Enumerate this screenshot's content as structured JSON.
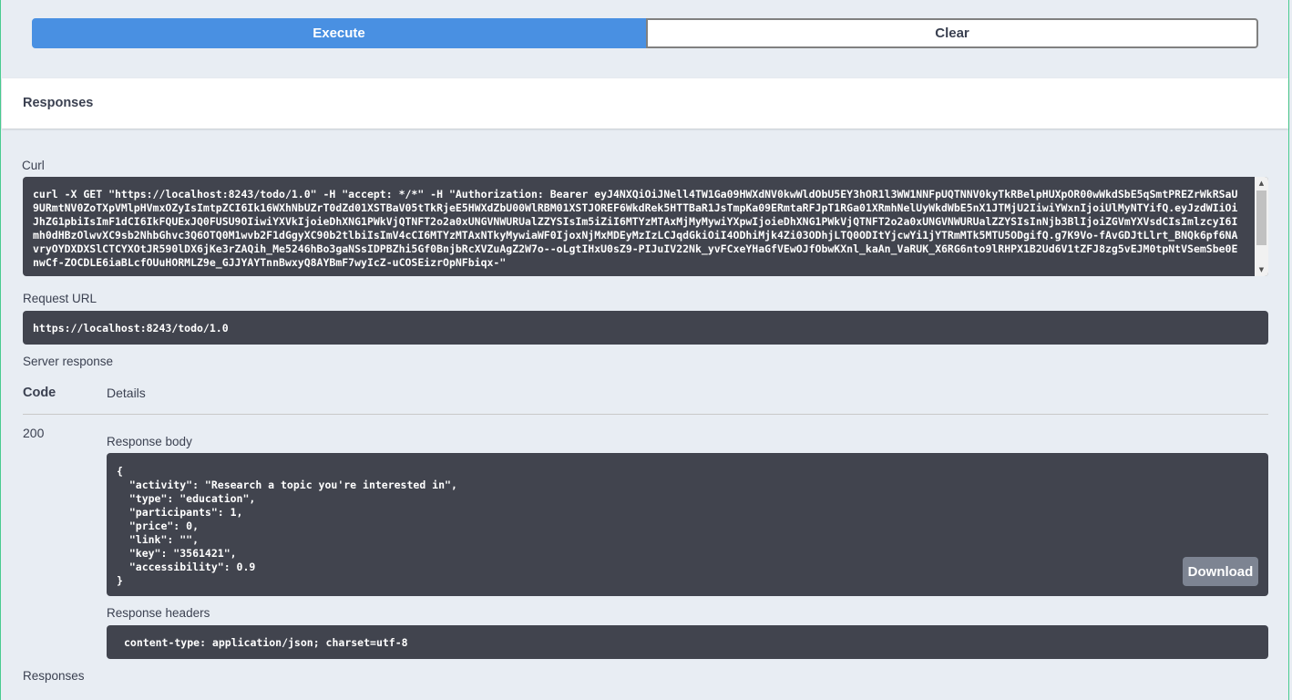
{
  "buttons": {
    "execute": "Execute",
    "clear": "Clear",
    "download": "Download"
  },
  "responses_title": "Responses",
  "curl": {
    "label": "Curl",
    "text": "curl -X GET \"https://localhost:8243/todo/1.0\" -H \"accept: */*\" -H \"Authorization: Bearer eyJ4NXQiOiJNell4TW1Ga09HWXdNV0kwWldObU5EY3hOR1l3WW1NNFpUQTNNV0kyTkRBelpHUXpOR00wWkdSbE5qSmtPREZrWkRSaU9URmtNV0ZoTXpVMlpHVmxOZyIsImtpZCI6Ik16WXhNbUZrT0dZd01XSTBaV05tTkRjeE5HWXdZbU00WlRBM01XSTJOREF6WkdRek5HTTBaR1JsTmpKa09ERmtaRFJpT1RGa01XRmhNelUyWkdWbE5nX1JTMjU2IiwiYWxnIjoiUlMyNTYifQ.eyJzdWIiOiJhZG1pbiIsImF1dCI6IkFQUExJQ0FUSU9OIiwiYXVkIjoieDhXNG1PWkVjQTNFT2o2a0xUNGVNWURUalZZYSIsIm5iZiI6MTYzMTAxMjMyMywiYXpwIjoieDhXNG1PWkVjQTNFT2o2a0xUNGVNWURUalZZYSIsInNjb3BlIjoiZGVmYXVsdCIsImlzcyI6Imh0dHBzOlwvXC9sb2NhbGhvc3Q6OTQ0M1wvb2F1dGgyXC90b2tlbiIsImV4cCI6MTYzMTAxNTkyMywiaWF0IjoxNjMxMDEyMzIzLCJqdGkiOiI4ODhiMjk4Zi03ODhjLTQ0ODItYjcwYi1jYTRmMTk5MTU5ODgifQ.g7K9Vo-fAvGDJtLlrt_BNQk6pf6NAvryOYDXDXSlCTCYXOtJR590lDX6jKe3rZAQih_Me5246hBo3gaNSsIDPBZhi5Gf0BnjbRcXVZuAgZ2W7o--oLgtIHxU0sZ9-PIJuIV22Nk_yvFCxeYHaGfVEwOJfObwKXnl_kaAn_VaRUK_X6RG6nto9lRHPX1B2Ud6V1tZFJ8zg5vEJM0tpNtVSemSbe0EnwCf-ZOCDLE6iaBLcfOUuHORMLZ9e_GJJYAYTnnBwxyQ8AYBmF7wyIcZ-uCOSEizrOpNFbiqx-\""
  },
  "request_url": {
    "label": "Request URL",
    "value": "https://localhost:8243/todo/1.0"
  },
  "server_response": {
    "label": "Server response",
    "col_code": "Code",
    "col_details": "Details",
    "code": "200"
  },
  "response_body": {
    "label": "Response body",
    "text": "{\n  \"activity\": \"Research a topic you're interested in\",\n  \"type\": \"education\",\n  \"participants\": 1,\n  \"price\": 0,\n  \"link\": \"\",\n  \"key\": \"3561421\",\n  \"accessibility\": 0.9\n}"
  },
  "response_headers": {
    "label": "Response headers",
    "text": "content-type: application/json; charset=utf-8"
  },
  "bottom_responses": "Responses"
}
